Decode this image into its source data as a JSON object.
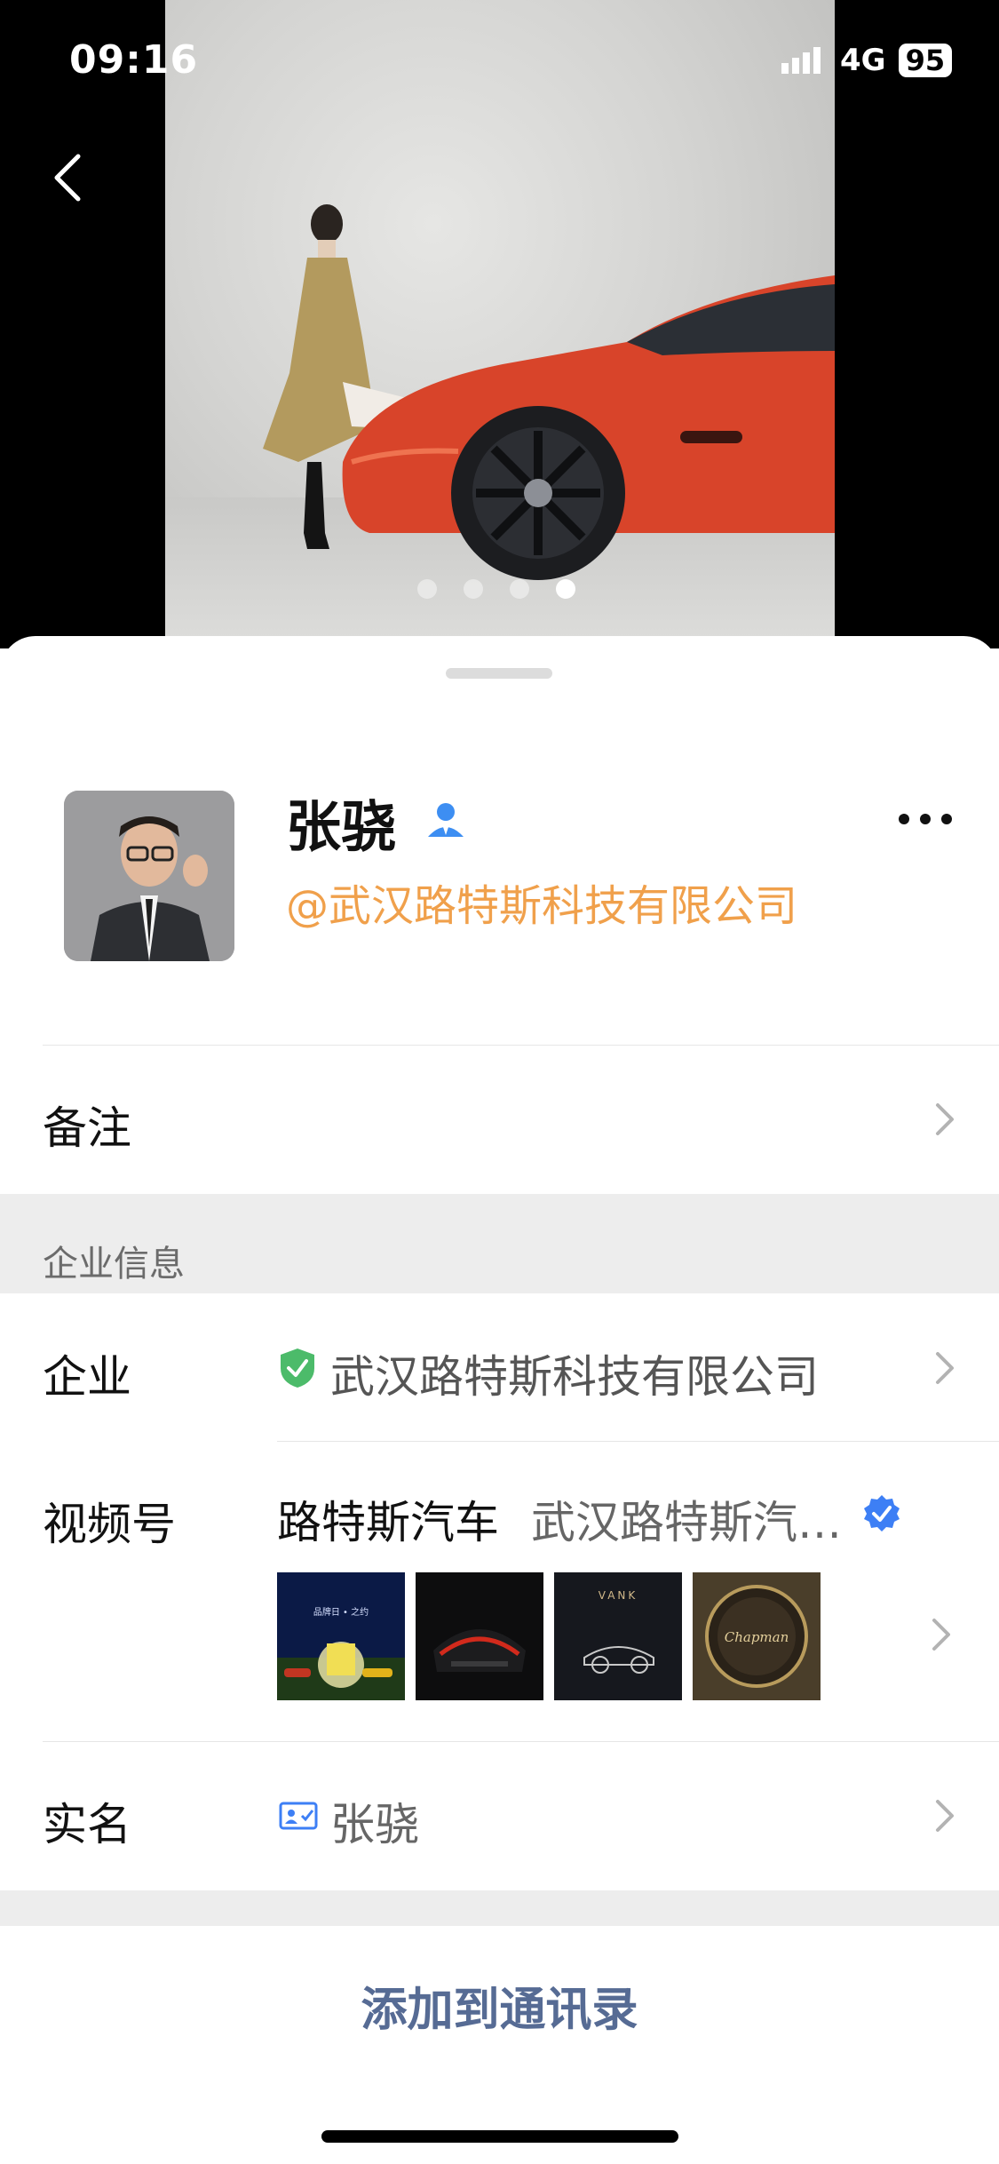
{
  "status_bar": {
    "time": "09:16",
    "network": "4G",
    "battery": "95"
  },
  "carousel": {
    "page_count": 4,
    "active_index": 3
  },
  "profile": {
    "name": "张骁",
    "company_tag": "@武汉路特斯科技有限公司"
  },
  "rows": {
    "remark_label": "备注",
    "section_title": "企业信息",
    "enterprise_label": "企业",
    "enterprise_value": "武汉路特斯科技有限公司",
    "channels_label": "视频号",
    "channels_name": "路特斯汽车",
    "channels_owner": "武汉路特斯汽…",
    "realname_label": "实名",
    "realname_value": "张骁"
  },
  "channels_thumbs": [
    {
      "text": "品牌日 • 之约",
      "scene": "night-cars"
    },
    {
      "text": "",
      "scene": "dark-car-rear"
    },
    {
      "text": "VANK",
      "scene": "car-sketch"
    },
    {
      "text": "Chapman",
      "scene": "gold-badge"
    }
  ],
  "actions": {
    "add_contact": "添加到通讯录"
  },
  "colors": {
    "company_tag": "#f0a04b",
    "verified_blue": "#3d7ff5",
    "shield_green": "#4cbb6a",
    "button_text": "#566b94"
  }
}
